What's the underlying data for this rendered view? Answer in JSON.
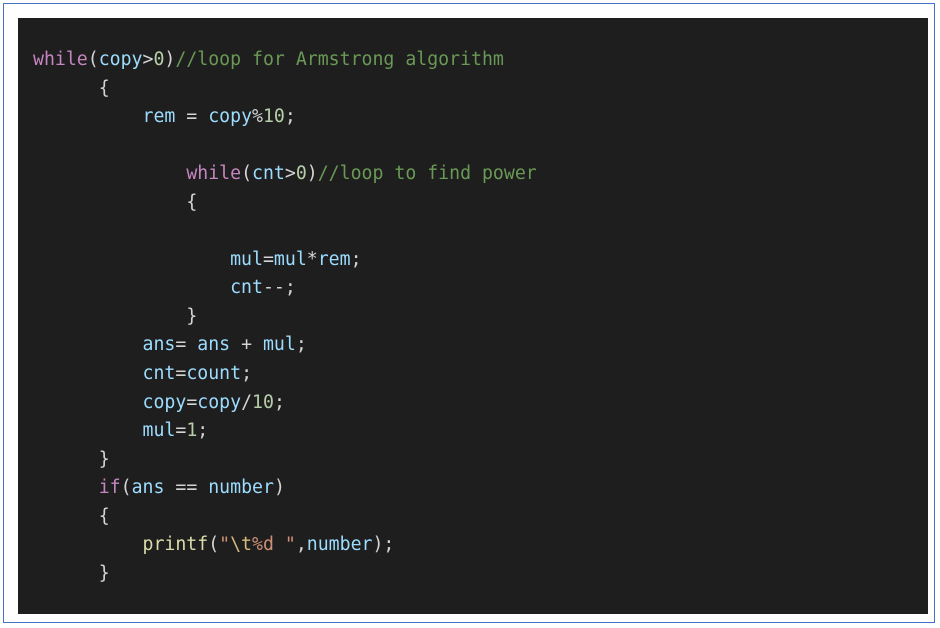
{
  "code_lines": [
    {
      "indent": "",
      "tokens": [
        {
          "t": "while",
          "c": "kw"
        },
        {
          "t": "(",
          "c": "pun"
        },
        {
          "t": "copy",
          "c": "var"
        },
        {
          "t": ">",
          "c": "pun"
        },
        {
          "t": "0",
          "c": "num"
        },
        {
          "t": ")",
          "c": "pun"
        },
        {
          "t": "//loop for Armstrong algorithm",
          "c": "cmt"
        }
      ]
    },
    {
      "indent": "      ",
      "tokens": [
        {
          "t": "{",
          "c": "pun"
        }
      ]
    },
    {
      "indent": "          ",
      "tokens": [
        {
          "t": "rem",
          "c": "var"
        },
        {
          "t": " = ",
          "c": "pun"
        },
        {
          "t": "copy",
          "c": "var"
        },
        {
          "t": "%",
          "c": "pun"
        },
        {
          "t": "10",
          "c": "num"
        },
        {
          "t": ";",
          "c": "pun"
        }
      ]
    },
    {
      "indent": "",
      "tokens": []
    },
    {
      "indent": "              ",
      "tokens": [
        {
          "t": "while",
          "c": "kw"
        },
        {
          "t": "(",
          "c": "pun"
        },
        {
          "t": "cnt",
          "c": "var"
        },
        {
          "t": ">",
          "c": "pun"
        },
        {
          "t": "0",
          "c": "num"
        },
        {
          "t": ")",
          "c": "pun"
        },
        {
          "t": "//loop to find power",
          "c": "cmt"
        }
      ]
    },
    {
      "indent": "              ",
      "tokens": [
        {
          "t": "{",
          "c": "pun"
        }
      ]
    },
    {
      "indent": "",
      "tokens": []
    },
    {
      "indent": "                  ",
      "tokens": [
        {
          "t": "mul",
          "c": "var"
        },
        {
          "t": "=",
          "c": "pun"
        },
        {
          "t": "mul",
          "c": "var"
        },
        {
          "t": "*",
          "c": "pun"
        },
        {
          "t": "rem",
          "c": "var"
        },
        {
          "t": ";",
          "c": "pun"
        }
      ]
    },
    {
      "indent": "                  ",
      "tokens": [
        {
          "t": "cnt",
          "c": "var"
        },
        {
          "t": "--;",
          "c": "pun"
        }
      ]
    },
    {
      "indent": "              ",
      "tokens": [
        {
          "t": "}",
          "c": "pun"
        }
      ]
    },
    {
      "indent": "          ",
      "tokens": [
        {
          "t": "ans",
          "c": "var"
        },
        {
          "t": "= ",
          "c": "pun"
        },
        {
          "t": "ans",
          "c": "var"
        },
        {
          "t": " + ",
          "c": "pun"
        },
        {
          "t": "mul",
          "c": "var"
        },
        {
          "t": ";",
          "c": "pun"
        }
      ]
    },
    {
      "indent": "          ",
      "tokens": [
        {
          "t": "cnt",
          "c": "var"
        },
        {
          "t": "=",
          "c": "pun"
        },
        {
          "t": "count",
          "c": "var"
        },
        {
          "t": ";",
          "c": "pun"
        }
      ]
    },
    {
      "indent": "          ",
      "tokens": [
        {
          "t": "copy",
          "c": "var"
        },
        {
          "t": "=",
          "c": "pun"
        },
        {
          "t": "copy",
          "c": "var"
        },
        {
          "t": "/",
          "c": "pun"
        },
        {
          "t": "10",
          "c": "num"
        },
        {
          "t": ";",
          "c": "pun"
        }
      ]
    },
    {
      "indent": "          ",
      "tokens": [
        {
          "t": "mul",
          "c": "var"
        },
        {
          "t": "=",
          "c": "pun"
        },
        {
          "t": "1",
          "c": "num"
        },
        {
          "t": ";",
          "c": "pun"
        }
      ]
    },
    {
      "indent": "      ",
      "tokens": [
        {
          "t": "}",
          "c": "pun"
        }
      ]
    },
    {
      "indent": "      ",
      "tokens": [
        {
          "t": "if",
          "c": "kw"
        },
        {
          "t": "(",
          "c": "pun"
        },
        {
          "t": "ans",
          "c": "var"
        },
        {
          "t": " == ",
          "c": "pun"
        },
        {
          "t": "number",
          "c": "var"
        },
        {
          "t": ")",
          "c": "pun"
        }
      ]
    },
    {
      "indent": "      ",
      "tokens": [
        {
          "t": "{",
          "c": "pun"
        }
      ]
    },
    {
      "indent": "          ",
      "tokens": [
        {
          "t": "printf",
          "c": "fn"
        },
        {
          "t": "(",
          "c": "pun"
        },
        {
          "t": "\"",
          "c": "str"
        },
        {
          "t": "\\t",
          "c": "esc"
        },
        {
          "t": "%d \"",
          "c": "str"
        },
        {
          "t": ",",
          "c": "pun"
        },
        {
          "t": "number",
          "c": "var"
        },
        {
          "t": ");",
          "c": "pun"
        }
      ]
    },
    {
      "indent": "      ",
      "tokens": [
        {
          "t": "}",
          "c": "pun"
        }
      ]
    }
  ]
}
